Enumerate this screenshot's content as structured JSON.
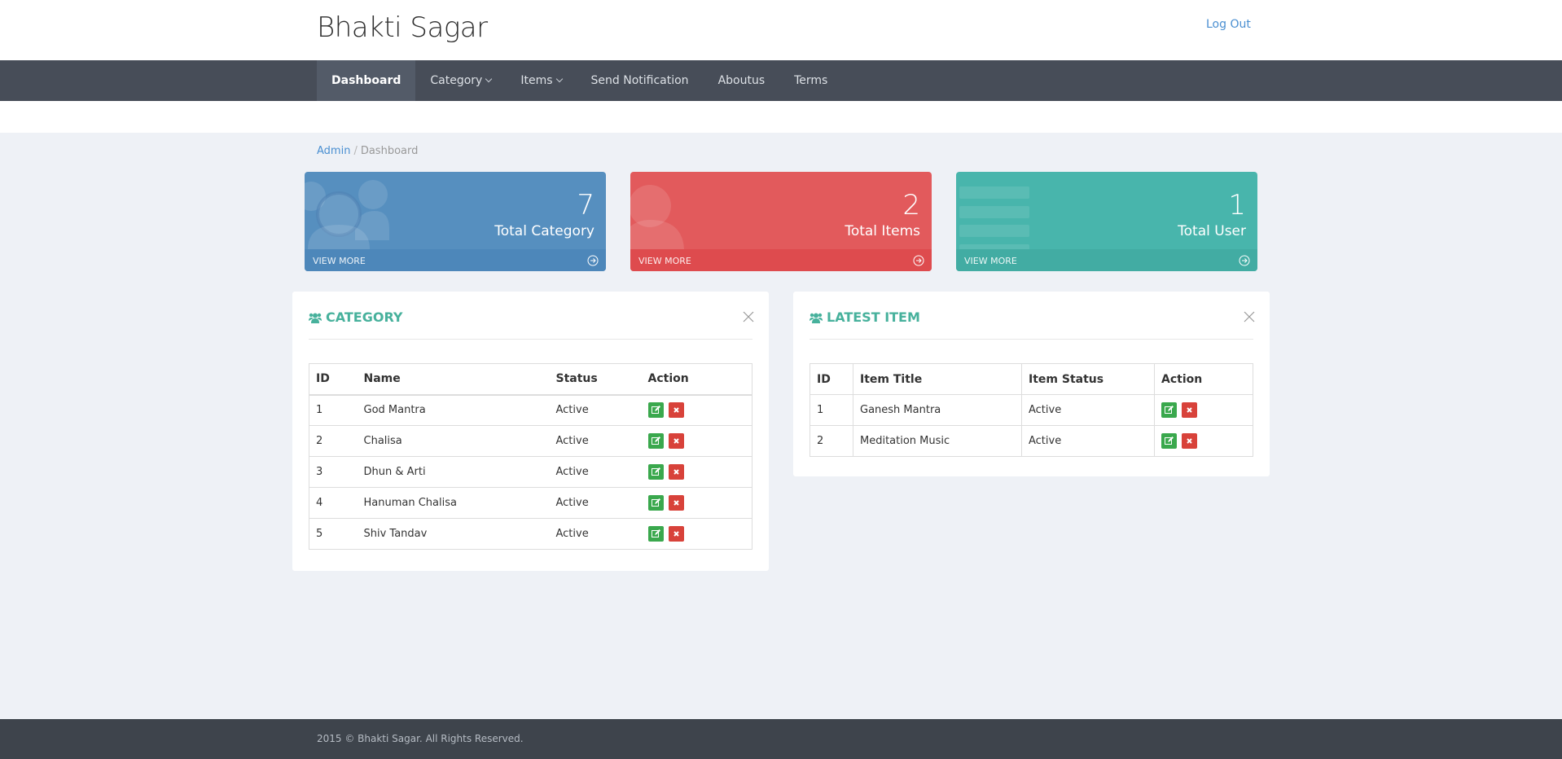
{
  "header": {
    "brand": "Bhakti Sagar",
    "logout_label": "Log Out"
  },
  "nav": {
    "items": [
      {
        "label": "Dashboard",
        "active": true,
        "dropdown": false
      },
      {
        "label": "Category",
        "active": false,
        "dropdown": true
      },
      {
        "label": "Items",
        "active": false,
        "dropdown": true
      },
      {
        "label": "Send Notification",
        "active": false,
        "dropdown": false
      },
      {
        "label": "Aboutus",
        "active": false,
        "dropdown": false
      },
      {
        "label": "Terms",
        "active": false,
        "dropdown": false
      }
    ]
  },
  "breadcrumb": {
    "root": "Admin",
    "separator": "/",
    "current": "Dashboard"
  },
  "stats": [
    {
      "value": "7",
      "label": "Total Category",
      "link": "VIEW MORE",
      "color": "#568fbf",
      "icon": "users-icon"
    },
    {
      "value": "2",
      "label": "Total Items",
      "link": "VIEW MORE",
      "color": "#e25a5c",
      "icon": "user-icon"
    },
    {
      "value": "1",
      "label": "Total User",
      "link": "VIEW MORE",
      "color": "#48b5ac",
      "icon": "list-icon"
    }
  ],
  "category_panel": {
    "title": "CATEGORY",
    "columns": [
      "ID",
      "Name",
      "Status",
      "Action"
    ],
    "rows": [
      {
        "id": "1",
        "name": "God Mantra",
        "status": "Active"
      },
      {
        "id": "2",
        "name": "Chalisa",
        "status": "Active"
      },
      {
        "id": "3",
        "name": "Dhun & Arti",
        "status": "Active"
      },
      {
        "id": "4",
        "name": "Hanuman Chalisa",
        "status": "Active"
      },
      {
        "id": "5",
        "name": "Shiv Tandav",
        "status": "Active"
      }
    ]
  },
  "latest_panel": {
    "title": "LATEST ITEM",
    "columns": [
      "ID",
      "Item Title",
      "Item Status",
      "Action"
    ],
    "rows": [
      {
        "id": "1",
        "title": "Ganesh Mantra",
        "status": "Active"
      },
      {
        "id": "2",
        "title": "Meditation Music",
        "status": "Active"
      }
    ]
  },
  "colors": {
    "accent_teal": "#47b19c",
    "link_blue": "#4a8fd1",
    "edit_green": "#3aa84d",
    "delete_red": "#d8423a",
    "navbar": "#474d58"
  },
  "footer": {
    "copyright": "2015 © Bhakti Sagar. All Rights Reserved."
  }
}
